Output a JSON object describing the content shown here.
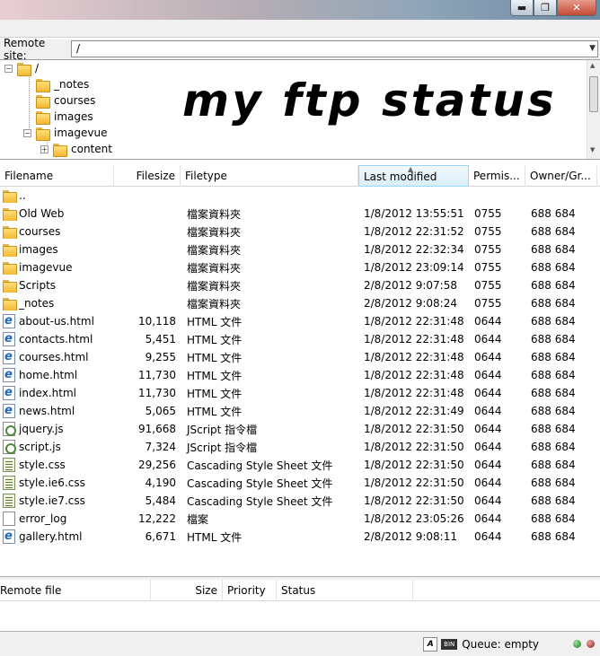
{
  "remote_site": {
    "label": "Remote site:",
    "path": "/"
  },
  "tree": {
    "root": "/",
    "items": [
      "_notes",
      "courses",
      "images",
      "imagevue",
      "content"
    ]
  },
  "banner_text": "my ftp status",
  "columns": {
    "filename": "Filename",
    "filesize": "Filesize",
    "filetype": "Filetype",
    "last_modified": "Last modified",
    "permissions": "Permis...",
    "owner": "Owner/Gr..."
  },
  "files": [
    {
      "name": "..",
      "size": "",
      "type": "",
      "modified": "",
      "perm": "",
      "owner": "",
      "icon": "folder-icon"
    },
    {
      "name": "Old Web",
      "size": "",
      "type": "檔案資料夾",
      "modified": "1/8/2012 13:55:51",
      "perm": "0755",
      "owner": "688 684",
      "icon": "folder-icon"
    },
    {
      "name": "courses",
      "size": "",
      "type": "檔案資料夾",
      "modified": "1/8/2012 22:31:52",
      "perm": "0755",
      "owner": "688 684",
      "icon": "folder-icon"
    },
    {
      "name": "images",
      "size": "",
      "type": "檔案資料夾",
      "modified": "1/8/2012 22:32:34",
      "perm": "0755",
      "owner": "688 684",
      "icon": "folder-icon"
    },
    {
      "name": "imagevue",
      "size": "",
      "type": "檔案資料夾",
      "modified": "1/8/2012 23:09:14",
      "perm": "0755",
      "owner": "688 684",
      "icon": "folder-icon"
    },
    {
      "name": "Scripts",
      "size": "",
      "type": "檔案資料夾",
      "modified": "2/8/2012 9:07:58",
      "perm": "0755",
      "owner": "688 684",
      "icon": "folder-icon"
    },
    {
      "name": "_notes",
      "size": "",
      "type": "檔案資料夾",
      "modified": "2/8/2012 9:08:24",
      "perm": "0755",
      "owner": "688 684",
      "icon": "folder-icon"
    },
    {
      "name": "about-us.html",
      "size": "10,118",
      "type": "HTML 文件",
      "modified": "1/8/2012 22:31:48",
      "perm": "0644",
      "owner": "688 684",
      "icon": "html-file-icon"
    },
    {
      "name": "contacts.html",
      "size": "5,451",
      "type": "HTML 文件",
      "modified": "1/8/2012 22:31:48",
      "perm": "0644",
      "owner": "688 684",
      "icon": "html-file-icon"
    },
    {
      "name": "courses.html",
      "size": "9,255",
      "type": "HTML 文件",
      "modified": "1/8/2012 22:31:48",
      "perm": "0644",
      "owner": "688 684",
      "icon": "html-file-icon"
    },
    {
      "name": "home.html",
      "size": "11,730",
      "type": "HTML 文件",
      "modified": "1/8/2012 22:31:48",
      "perm": "0644",
      "owner": "688 684",
      "icon": "html-file-icon"
    },
    {
      "name": "index.html",
      "size": "11,730",
      "type": "HTML 文件",
      "modified": "1/8/2012 22:31:48",
      "perm": "0644",
      "owner": "688 684",
      "icon": "html-file-icon"
    },
    {
      "name": "news.html",
      "size": "5,065",
      "type": "HTML 文件",
      "modified": "1/8/2012 22:31:49",
      "perm": "0644",
      "owner": "688 684",
      "icon": "html-file-icon"
    },
    {
      "name": "jquery.js",
      "size": "91,668",
      "type": "JScript 指令檔",
      "modified": "1/8/2012 22:31:50",
      "perm": "0644",
      "owner": "688 684",
      "icon": "js-file-icon"
    },
    {
      "name": "script.js",
      "size": "7,324",
      "type": "JScript 指令檔",
      "modified": "1/8/2012 22:31:50",
      "perm": "0644",
      "owner": "688 684",
      "icon": "js-file-icon"
    },
    {
      "name": "style.css",
      "size": "29,256",
      "type": "Cascading Style Sheet 文件",
      "modified": "1/8/2012 22:31:50",
      "perm": "0644",
      "owner": "688 684",
      "icon": "css-file-icon"
    },
    {
      "name": "style.ie6.css",
      "size": "4,190",
      "type": "Cascading Style Sheet 文件",
      "modified": "1/8/2012 22:31:50",
      "perm": "0644",
      "owner": "688 684",
      "icon": "css-file-icon"
    },
    {
      "name": "style.ie7.css",
      "size": "5,484",
      "type": "Cascading Style Sheet 文件",
      "modified": "1/8/2012 22:31:50",
      "perm": "0644",
      "owner": "688 684",
      "icon": "css-file-icon"
    },
    {
      "name": "error_log",
      "size": "12,222",
      "type": "檔案",
      "modified": "1/8/2012 23:05:26",
      "perm": "0644",
      "owner": "688 684",
      "icon": "generic-file-icon"
    },
    {
      "name": "gallery.html",
      "size": "6,671",
      "type": "HTML 文件",
      "modified": "2/8/2012 9:08:11",
      "perm": "0644",
      "owner": "688 684",
      "icon": "html-file-icon"
    }
  ],
  "queue_columns": {
    "remote_file": "Remote file",
    "size": "Size",
    "priority": "Priority",
    "status": "Status"
  },
  "statusbar": {
    "queue": "Queue: empty"
  },
  "window_buttons": {
    "minimize": "▬",
    "maximize": "❐",
    "close": "✕"
  }
}
